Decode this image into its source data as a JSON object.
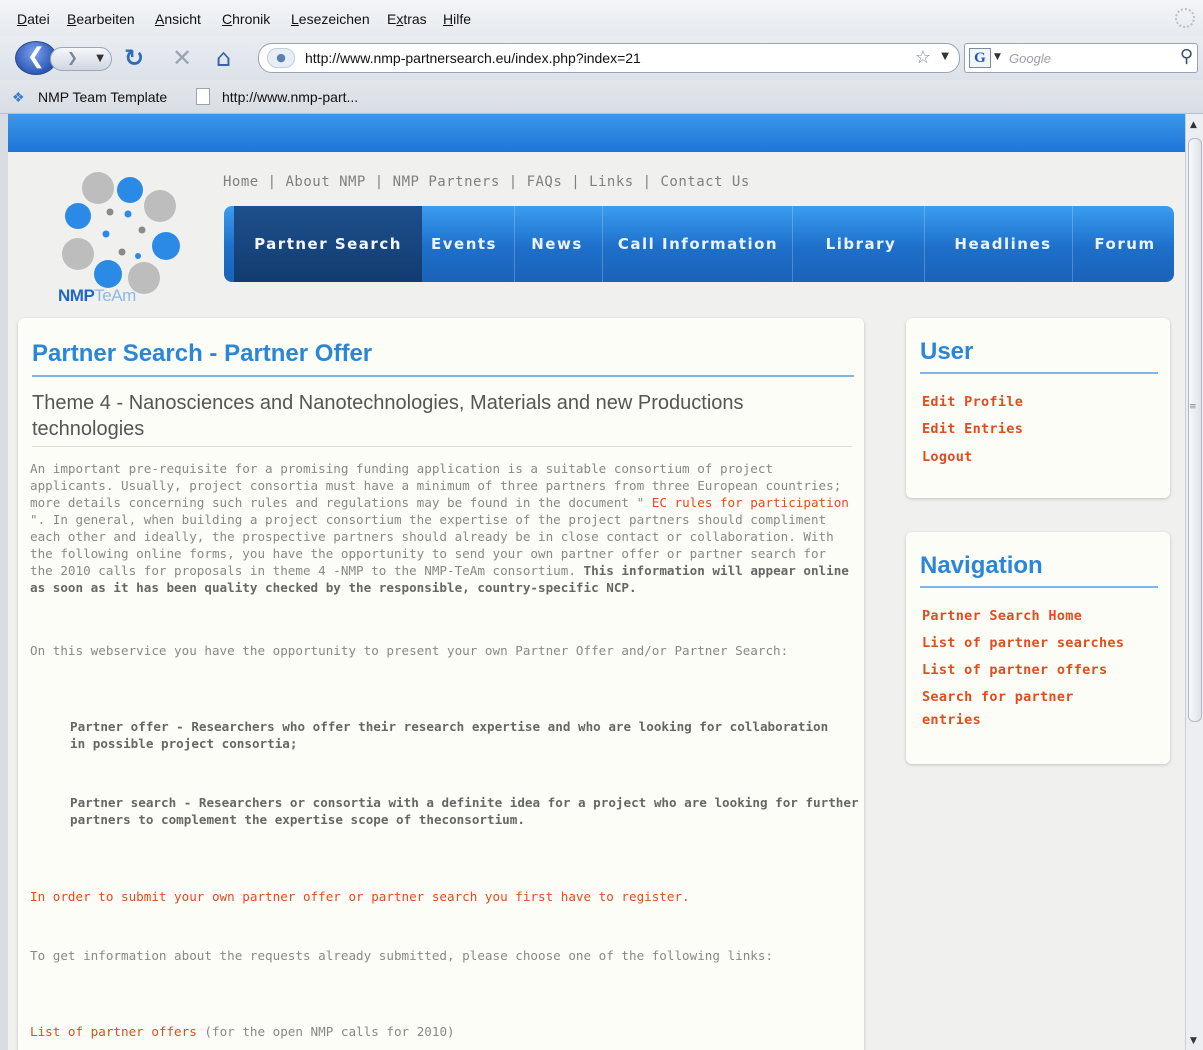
{
  "browser": {
    "menu": [
      "Datei",
      "Bearbeiten",
      "Ansicht",
      "Chronik",
      "Lesezeichen",
      "Extras",
      "Hilfe"
    ],
    "menu_underline": [
      "D",
      "B",
      "A",
      "C",
      "L",
      "x",
      "H"
    ],
    "url": "http://www.nmp-partnersearch.eu/index.php?index=21",
    "search_placeholder": "Google",
    "bookmarks": [
      "NMP Team Template",
      "http://www.nmp-part..."
    ]
  },
  "site": {
    "logo_text_a": "NMP",
    "logo_text_b": "TeAm",
    "top_links": "Home | About NMP | NMP Partners | FAQs | Links | Contact Us",
    "tabs": [
      "Partner Search",
      "Events",
      "News",
      "Call Information",
      "Library",
      "Headlines",
      "Forum"
    ],
    "active_tab": "Partner Search"
  },
  "main": {
    "title": "Partner Search - Partner Offer",
    "theme": "Theme 4 - Nanosciences and Nanotechnologies, Materials and new Productions technologies",
    "intro_1": "An important pre-requisite for a promising funding application is a suitable consortium of project applicants. Usually, project consortia must have a minimum of three partners from three European countries; more details concerning such rules and regulations may be found in the document \"",
    "intro_link": " EC rules for participation ",
    "intro_2": "\". In general, when building a project consortium the expertise of the project partners should compliment each other and ideally, the prospective partners should already be in close contact or collaboration. With the following online forms, you have the opportunity to send your own partner offer or partner search for the 2010 calls for proposals in theme 4 -NMP to the NMP-TeAm consortium.",
    "intro_bold": "This information will appear online as soon as it has been quality checked by the responsible, country-specific NCP.",
    "webservice": "On this webservice you have the opportunity to present your own Partner Offer and/or Partner Search:",
    "offer_item": "Partner offer  - Researchers who offer their research expertise and who are looking for collaboration in possible project consortia;",
    "search_item": "Partner search  - Researchers or consortia with a definite idea for a project who are looking for further partners to complement the expertise scope of theconsortium.",
    "register_note": "In order to submit your own partner offer or partner search you first have to register.",
    "requests_note": "To get information about the requests already submitted, please choose one of the following links:",
    "list_offers_link": "List of partner offers",
    "list_offers_note": "(for the open NMP calls for 2010)"
  },
  "sidebar": {
    "user_title": "User",
    "user_links": [
      "Edit Profile",
      "Edit Entries",
      "Logout"
    ],
    "nav_title": "Navigation",
    "nav_links": [
      "Partner Search Home",
      "List of partner searches",
      "List of partner offers",
      "Search for partner",
      "entries"
    ]
  },
  "colors": {
    "accent_blue": "#2b86d6",
    "nav_blue": "#1e6fc9",
    "link_red": "#e04c1f"
  }
}
